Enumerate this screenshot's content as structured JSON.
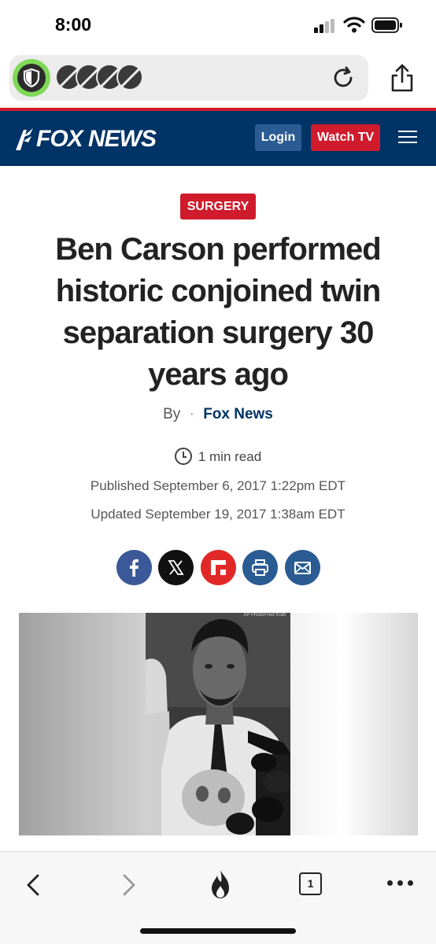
{
  "status_bar": {
    "time": "8:00"
  },
  "browser": {
    "shield_color": "#7ed957",
    "blocked_icons": [
      "blocked-tracker-icon",
      "blocked-tracker-icon",
      "blocked-tracker-icon",
      "blocked-tracker-icon"
    ]
  },
  "site": {
    "logo_text": "FOX NEWS",
    "login_label": "Login",
    "watch_label": "Watch TV",
    "brand_color": "#003366",
    "accent_color": "#cf1b2c"
  },
  "article": {
    "category": "SURGERY",
    "headline": "Ben Carson performed historic conjoined twin separation surgery 30 years ago",
    "by_label": "By",
    "by_separator": "·",
    "author": "Fox News",
    "read_time": "1 min read",
    "published": "Published September 6, 2017 1:22pm EDT",
    "updated": "Updated September 19, 2017 1:38am EDT",
    "share_icons": [
      {
        "name": "facebook-share-icon",
        "color": "#3b5998"
      },
      {
        "name": "x-share-icon",
        "color": "#111111"
      },
      {
        "name": "flipboard-share-icon",
        "color": "#e12828"
      },
      {
        "name": "print-share-icon",
        "color": "#2a5c93"
      },
      {
        "name": "email-share-icon",
        "color": "#2a5c93"
      }
    ],
    "photo_credit": "AP Photo/Fred Kraft"
  },
  "toolbar": {
    "tab_count": "1"
  }
}
